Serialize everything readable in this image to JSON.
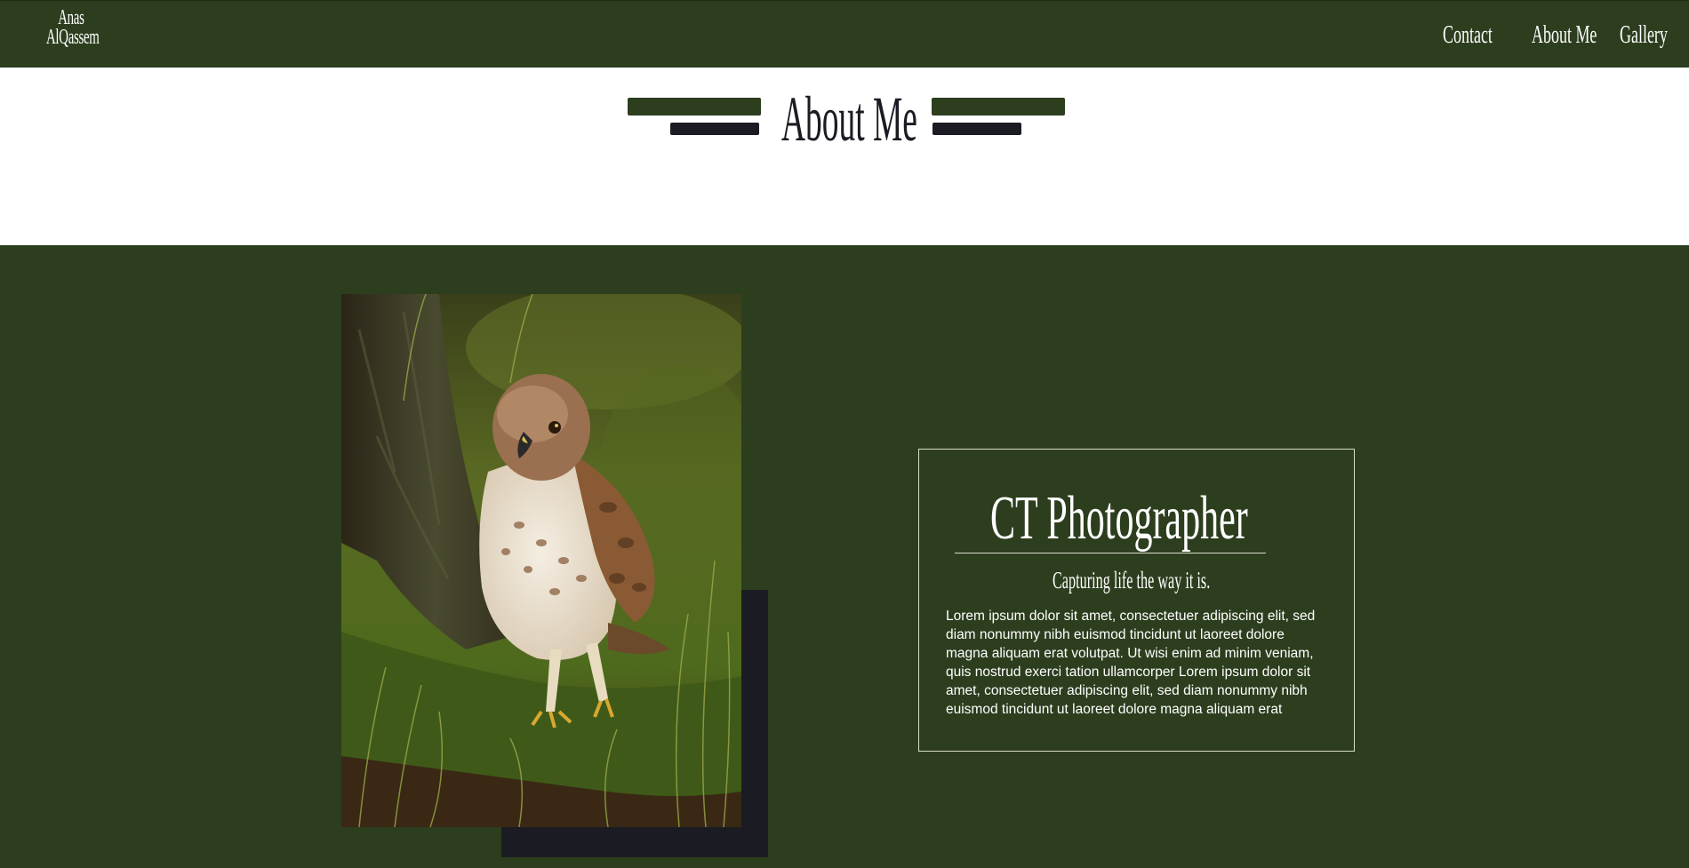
{
  "header": {
    "logo_line1": "Anas",
    "logo_line2": "AlQassem",
    "nav": [
      {
        "label": "Contact"
      },
      {
        "label": "About Me"
      },
      {
        "label": "Gallery"
      }
    ]
  },
  "about": {
    "title": "About Me"
  },
  "photo": {
    "subject": "hawk-standing-in-grass-photo"
  },
  "card": {
    "title": "CT Photographer",
    "tagline": "Capturing life the way it is.",
    "body": "Lorem ipsum dolor sit amet, consectetuer adipiscing elit, sed diam nonummy nibh euismod tincidunt ut laoreet dolore magna aliquam erat volutpat. Ut wisi enim ad minim veniam, quis nostrud exerci tation ullamcorper Lorem ipsum dolor sit amet, consectetuer adipiscing elit, sed diam nonummy nibh euismod tincidunt ut laoreet dolore magna aliquam erat"
  },
  "colors": {
    "forest_green": "#2c3e1e",
    "dark_navy": "#1b1c23",
    "white": "#ffffff"
  }
}
